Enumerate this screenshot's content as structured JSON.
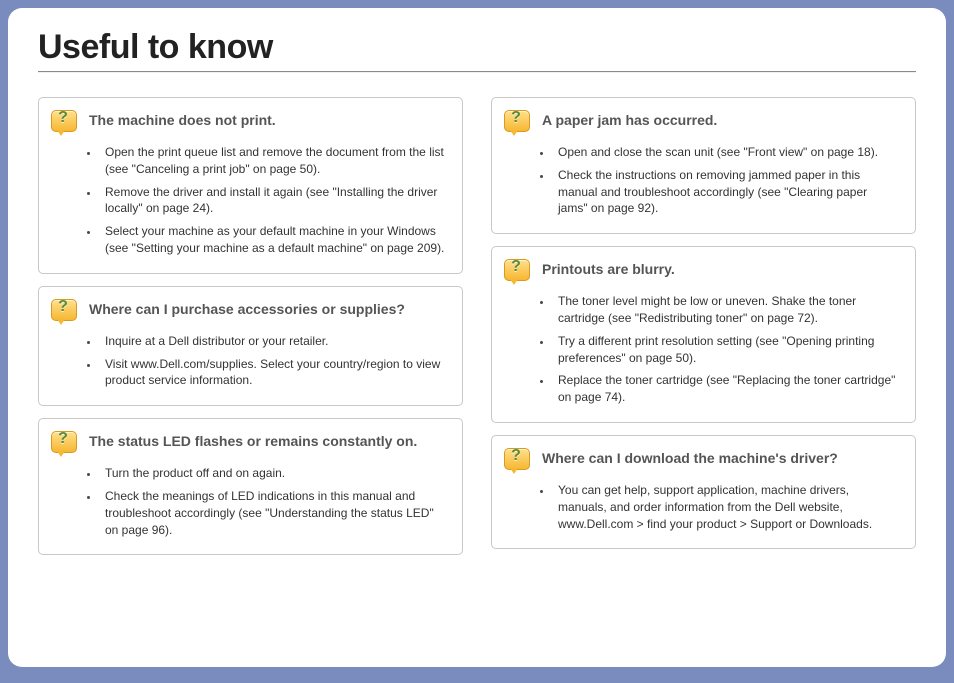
{
  "title": "Useful to know",
  "left": [
    {
      "heading": "The machine does not print.",
      "items": [
        "Open the print queue list and remove the document from the list (see \"Canceling a print job\" on page 50).",
        "Remove the driver and install it again (see \"Installing the driver locally\" on page 24).",
        "Select your machine as your default machine in your Windows (see \"Setting your machine as a default machine\" on page 209)."
      ]
    },
    {
      "heading": "Where can I purchase accessories or supplies?",
      "items": [
        "Inquire at a Dell distributor or your retailer.",
        "Visit www.Dell.com/supplies. Select your country/region to view product service information."
      ]
    },
    {
      "heading": "The status LED flashes or remains constantly on.",
      "items": [
        "Turn the product off and on again.",
        "Check the meanings of LED indications in this manual and troubleshoot accordingly (see \"Understanding the status LED\" on page 96)."
      ]
    }
  ],
  "right": [
    {
      "heading": "A paper jam has occurred.",
      "items": [
        "Open and close the scan unit (see \"Front view\" on page 18).",
        "Check the instructions on removing jammed paper in this manual and troubleshoot accordingly (see \"Clearing paper jams\" on page 92)."
      ]
    },
    {
      "heading": "Printouts are blurry.",
      "items": [
        "The toner level might be low or uneven. Shake the toner cartridge (see \"Redistributing toner\" on page 72).",
        "Try a different print resolution setting (see \"Opening printing preferences\" on page 50).",
        "Replace the toner cartridge (see \"Replacing the toner cartridge\" on page 74)."
      ]
    },
    {
      "heading": "Where can I download the machine's driver?",
      "items": [
        "You can get help, support application, machine drivers, manuals, and order information from the Dell website, www.Dell.com > find your product > Support or Downloads."
      ]
    }
  ]
}
